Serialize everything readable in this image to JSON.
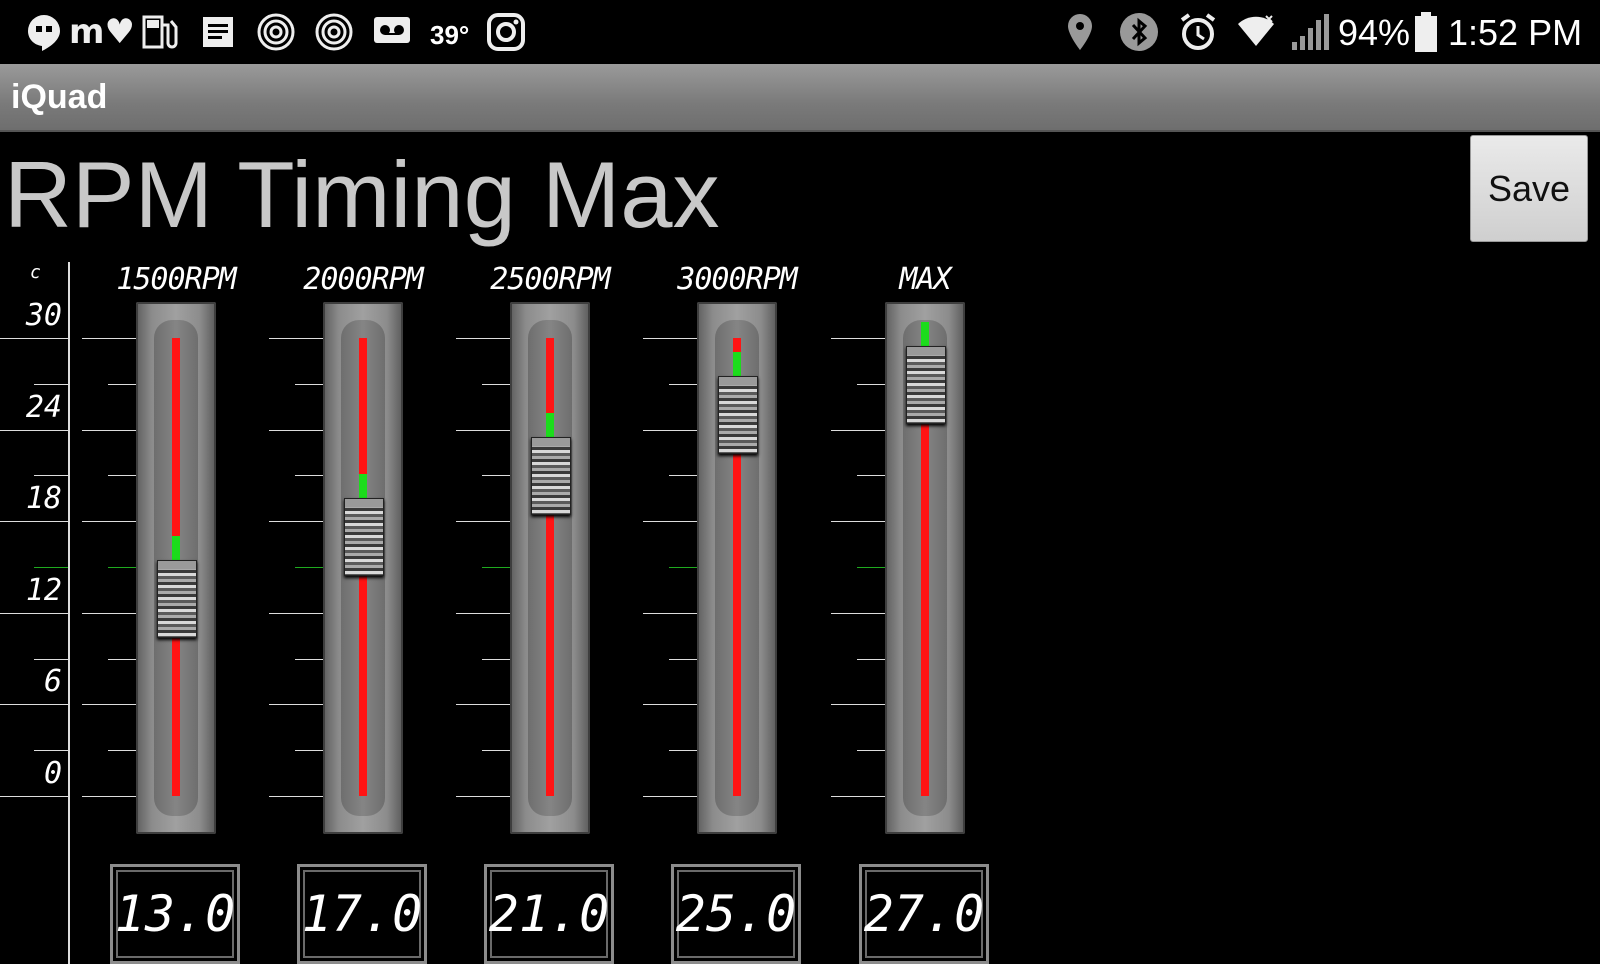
{
  "status_bar": {
    "battery_percent": "94%",
    "time": "1:52 PM",
    "temperature": "39°",
    "left_icons": [
      "hangouts-icon",
      "messenger-icon",
      "fuel-icon",
      "notes-icon",
      "fingerprint-icon",
      "fingerprint-icon",
      "voicemail-icon",
      "weather-icon",
      "instagram-icon"
    ],
    "right_icons": [
      "location-pin-icon",
      "bluetooth-icon",
      "alarm-icon",
      "wifi-icon",
      "cell-signal-icon",
      "battery-icon"
    ]
  },
  "app_bar": {
    "title": "iQuad"
  },
  "page": {
    "title": "RPM Timing Max",
    "save_label": "Save"
  },
  "scale": {
    "unit": "c",
    "labels": [
      "30",
      "24",
      "18",
      "12",
      "6",
      "0"
    ],
    "min": 0,
    "max": 30
  },
  "sliders": [
    {
      "label": "1500RPM",
      "value": 13.0,
      "display": "13.0"
    },
    {
      "label": "2000RPM",
      "value": 17.0,
      "display": "17.0"
    },
    {
      "label": "2500RPM",
      "value": 21.0,
      "display": "21.0"
    },
    {
      "label": "3000RPM",
      "value": 25.0,
      "display": "25.0"
    },
    {
      "label": "MAX",
      "value": 27.0,
      "display": "27.0"
    }
  ],
  "colors": {
    "track_bar": "#ff1414",
    "indicator": "#1cdc1c",
    "green_tick": "#1faa1f"
  }
}
